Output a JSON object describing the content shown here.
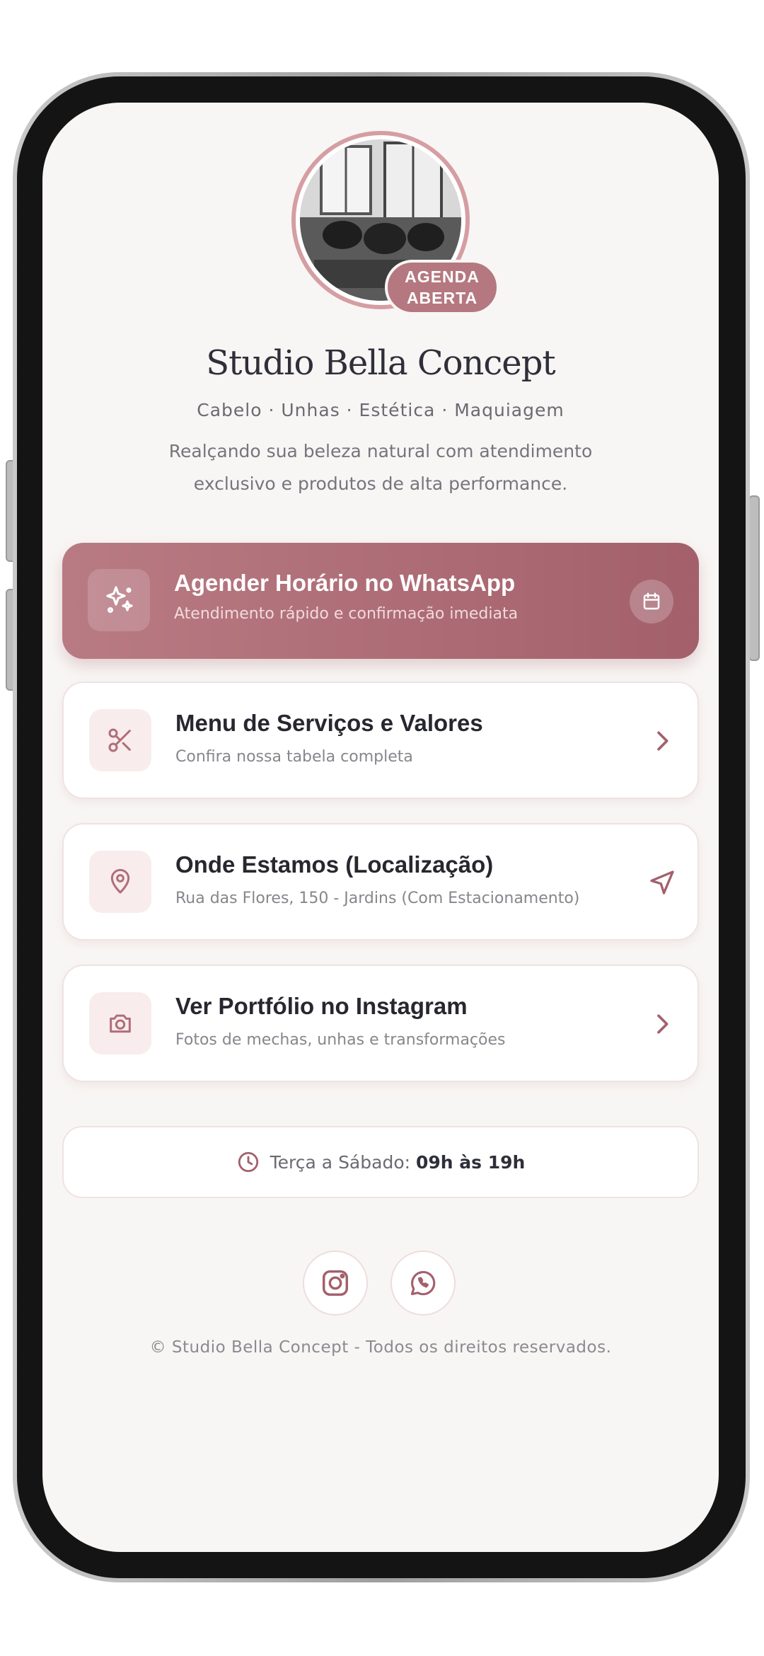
{
  "profile": {
    "status_line1": "AGENDA",
    "status_line2": "ABERTA",
    "name": "Studio Bella Concept",
    "categories": "Cabelo · Unhas · Estética · Maquiagem",
    "description": "Realçando sua beleza natural com atendimento exclusivo e produtos de alta performance."
  },
  "links": [
    {
      "title": "Agender Horário no WhatsApp",
      "subtitle": "Atendimento rápido e confirmação imediata",
      "icon": "sparkles-icon",
      "trailing_icon": "calendar-icon"
    },
    {
      "title": "Menu de Serviços e Valores",
      "subtitle": "Confira nossa tabela completa",
      "icon": "scissors-icon",
      "trailing_icon": "chevron-right-icon"
    },
    {
      "title": "Onde Estamos (Localização)",
      "subtitle": "Rua das Flores, 150 - Jardins (Com Estacionamento)",
      "icon": "map-pin-icon",
      "trailing_icon": "navigation-icon"
    },
    {
      "title": "Ver Portfólio no Instagram",
      "subtitle": "Fotos de mechas, unhas e transformações",
      "icon": "camera-icon",
      "trailing_icon": "chevron-right-icon"
    }
  ],
  "hours": {
    "label": "Terça a Sábado:",
    "value": "09h às 19h",
    "icon": "clock-icon"
  },
  "socials": [
    {
      "name": "instagram-icon"
    },
    {
      "name": "whatsapp-icon"
    }
  ],
  "footer": {
    "copyright": "© Studio Bella Concept - Todos os direitos reservados."
  },
  "colors": {
    "accent": "#a3606b",
    "accent_light": "#b97b83",
    "background": "#f8f6f4",
    "text_dark": "#27272f"
  }
}
